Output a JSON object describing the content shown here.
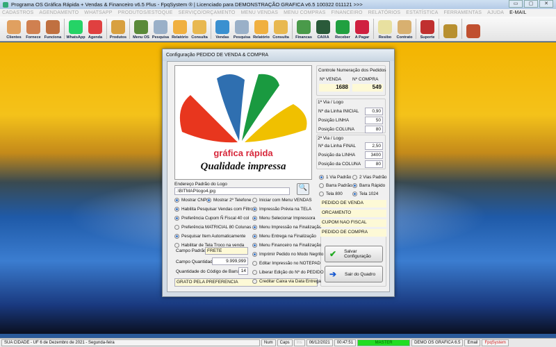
{
  "window": {
    "title": "Programa OS Gráfica Rápida + Vendas & Financeiro v6.5 Plus - FpqSystem ® | Licenciado para  DEMONSTRAÇÃO GRAFICA v6.5 100322 011121 >>>",
    "min": "▭",
    "max": "▢",
    "close": "✕"
  },
  "menu": [
    "CADASTROS",
    "AGENDAMENTO",
    "WHATSAPP",
    "PRODUTOS/ESTOQUE",
    "SERVIÇO/ORÇAMENTO",
    "MENU VENDAS",
    "MENU COMPRAS",
    "FINANCEIRO",
    "RELATÓRIOS",
    "ESTATÍSTICA",
    "FERRAMENTAS",
    "AJUDA"
  ],
  "menu_email": "E-MAIL",
  "toolbar": [
    {
      "label": "Clientes",
      "color": "#e0a060"
    },
    {
      "label": "Fornece",
      "color": "#d08050"
    },
    {
      "label": "Funciona",
      "color": "#c07040"
    },
    {
      "label": "WhatsApp",
      "color": "#25d366"
    },
    {
      "label": "Agenda",
      "color": "#e04040"
    },
    {
      "label": "Produtos",
      "color": "#d8a040"
    },
    {
      "label": "Menu OS",
      "color": "#5a8a3a"
    },
    {
      "label": "Pesquisa",
      "color": "#9ab0c8"
    },
    {
      "label": "Relatório",
      "color": "#f0b040"
    },
    {
      "label": "Consulta",
      "color": "#e8b850"
    },
    {
      "label": "Vendas",
      "color": "#3a90d0"
    },
    {
      "label": "Pesquisa",
      "color": "#9ab0c8"
    },
    {
      "label": "Relatório",
      "color": "#f0b040"
    },
    {
      "label": "Consulta",
      "color": "#e8b850"
    },
    {
      "label": "Financas",
      "color": "#4a9a4a"
    },
    {
      "label": "CAIXA",
      "color": "#2a5a3a"
    },
    {
      "label": "Receber",
      "color": "#20a040"
    },
    {
      "label": "A Pagar",
      "color": "#d02040"
    },
    {
      "label": "Resibo",
      "color": "#e8e0a0"
    },
    {
      "label": "Contrato",
      "color": "#d8b070"
    },
    {
      "label": "Suporte",
      "color": "#c03030"
    },
    {
      "label": "",
      "color": "#b89030"
    },
    {
      "label": "",
      "color": "#c05030"
    }
  ],
  "dialog": {
    "title": "Configuração PEDIDO DE VENDA & COMPRA",
    "logo_text1": "gráfica rápida",
    "logo_text2": "Qualidade impressa",
    "controle_title": "Controle Numeração dos Pedidos",
    "venda_label": "Nº VENDA",
    "venda_value": "1688",
    "compra_label": "Nº COMPRA",
    "compra_value": "549",
    "via1_title": "1ª Via / Logo",
    "via1": [
      {
        "label": "Nº da Linha INICIAL",
        "value": "0,90"
      },
      {
        "label": "Posição LINHA",
        "value": "50"
      },
      {
        "label": "Posição COLUNA",
        "value": "80"
      }
    ],
    "via2_title": "2ª Via / Logo",
    "via2": [
      {
        "label": "Nº da Linha FINAL",
        "value": "2,50"
      },
      {
        "label": "Posição da LINHA",
        "value": "3400"
      },
      {
        "label": "Posição da COLUNA",
        "value": "80"
      }
    ],
    "logo_path_label": "Endereço Padrão do Logo",
    "logo_path": ".\\BITMAP\\logo4.jpg",
    "left_options": [
      {
        "label": "Habilita Pesquisar Vendas com Filtro",
        "on": true
      },
      {
        "label": "Preferência Cupom Ñ Fiscal 40 col",
        "on": true
      },
      {
        "label": "Preferência MATRICIAL 80 Colunas",
        "on": false
      },
      {
        "label": "Pesquisar Item Automaticamente",
        "on": true
      },
      {
        "label": "Habilitar de Tela Troco na venda",
        "on": false
      }
    ],
    "cnpj": {
      "label": "Mostrar CNPJ",
      "on": true
    },
    "tel2": {
      "label": "Mostrar 2º Telefone",
      "on": true
    },
    "mid_options": [
      {
        "label": "Iniciar com Menu VENDAS",
        "on": false
      },
      {
        "label": "Impressão Prévia na TELA",
        "on": true
      },
      {
        "label": "Menu Selecionar Impressora",
        "on": true
      },
      {
        "label": "Menu Impressão na Finalização",
        "on": true
      },
      {
        "label": "Menu Entrega na Finalização",
        "on": true
      },
      {
        "label": "Menu Financeiro na Finalização",
        "on": true
      },
      {
        "label": "Imprimir Pedido no Modo Negrito",
        "on": true
      },
      {
        "label": "Editar Impressão no NOTEPAD",
        "on": false
      },
      {
        "label": "Liberar Edição do Nº do PEDIDO",
        "on": false
      },
      {
        "label": "Creditar Caixa via Data Entrega",
        "on": false
      }
    ],
    "campo_padrao_label": "Campo Padrão",
    "campo_padrao": "FRETE",
    "campo_qtd_label": "Campo Quantidade",
    "campo_qtd": "9.999,999",
    "codbarras_label": "Quantidade do Código de Barras",
    "codbarras": "14",
    "rodape": "GRATO PELA PREFERENCIA",
    "right_options": [
      {
        "label": "1 Via Padrão",
        "on": true
      },
      {
        "label": "2 Vias Padrão",
        "on": false
      },
      {
        "label": "Barra Padrão",
        "on": false
      },
      {
        "label": "Barra Rápido",
        "on": true
      },
      {
        "label": "Tela 800",
        "on": false
      },
      {
        "label": "Tela 1024",
        "on": true
      }
    ],
    "doc_titles": [
      "PEDIDO DE VENDA",
      "ORCAMENTO",
      "CUPOM NAO FISCAL",
      "PEDIDO DE COMPRA"
    ],
    "save_label": "Salvar Configuração",
    "exit_label": "Sair do Quadro"
  },
  "status": {
    "city": "SUA CIDADE - UF  6 de Dezembro de 2021 - Segunda-feira",
    "num": "Num",
    "caps": "Caps",
    "ins": "Ins",
    "date": "06/12/2021",
    "time": "00:47:51",
    "user": "MASTER",
    "db": "DEMO OS GRAFICA 6.5",
    "email": "Email",
    "brand": "FpqSystem"
  }
}
